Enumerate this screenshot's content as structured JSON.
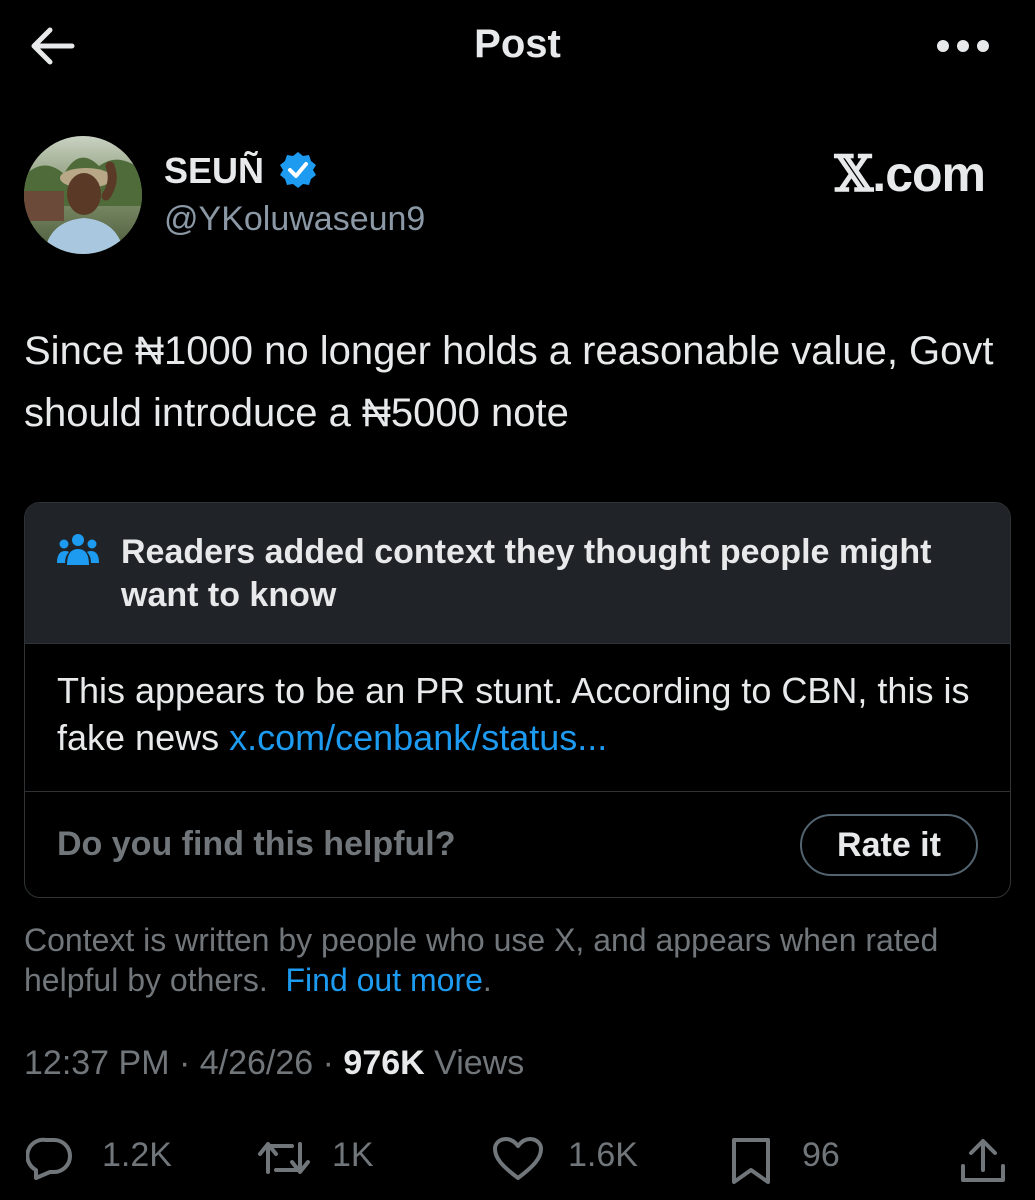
{
  "header": {
    "title": "Post",
    "back_icon": "arrow-left-icon",
    "more_icon": "more-horizontal-icon"
  },
  "author": {
    "display_name": "SEUÑ",
    "handle": "@YKoluwaseun9",
    "verified_icon": "verified-badge-icon",
    "verified_color": "#1d9bf0"
  },
  "watermark": {
    "x": "𝕏",
    "suffix": ".com"
  },
  "post": {
    "text": "Since ₦1000 no longer holds a reasonable value, Govt should introduce a ₦5000 note"
  },
  "community_note": {
    "icon": "people-icon",
    "title": "Readers added context they thought people might want to know",
    "body": "This appears to be an PR stunt. According to CBN, this is fake news ",
    "link_text": "x.com/cenbank/status...",
    "helpful_question": "Do you find this helpful?",
    "rate_label": "Rate it"
  },
  "context_info": {
    "text": "Context is written by people who use X, and appears when rated helpful by others.",
    "link_text": "Find out more",
    "period": "."
  },
  "meta": {
    "time": "12:37 PM",
    "separator": " · ",
    "date": "4/26/26",
    "views_count": "976K",
    "views_label": " Views"
  },
  "actions": {
    "reply": {
      "icon": "reply-icon",
      "count": "1.2K"
    },
    "repost": {
      "icon": "repost-icon",
      "count": "1K"
    },
    "like": {
      "icon": "heart-icon",
      "count": "1.6K"
    },
    "bookmark": {
      "icon": "bookmark-icon",
      "count": "96"
    },
    "share": {
      "icon": "share-icon"
    }
  },
  "colors": {
    "background": "#000000",
    "text": "#e7e9ea",
    "secondary": "#71767b",
    "accent": "#1d9bf0",
    "note_header_bg": "#202327"
  }
}
